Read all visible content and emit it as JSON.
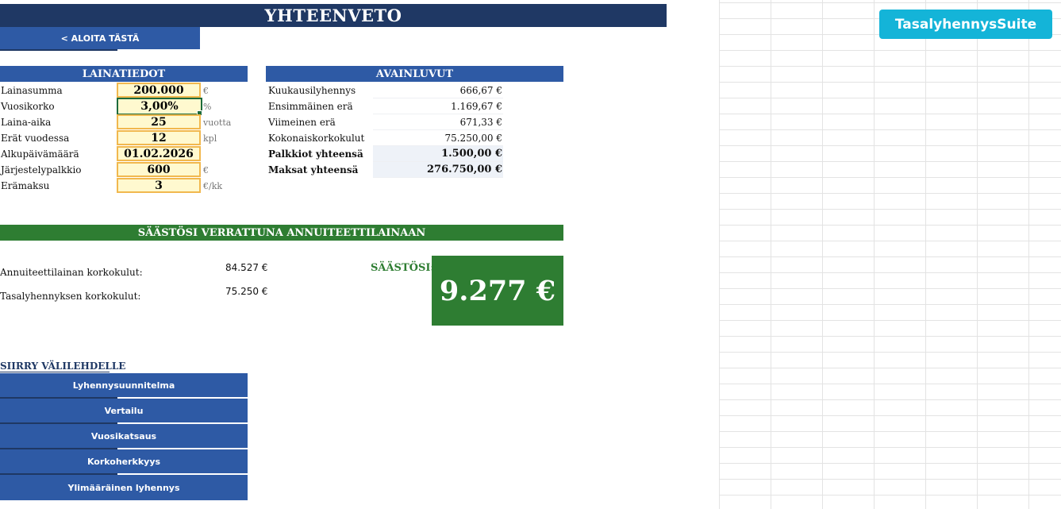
{
  "header": {
    "title": "YHTEENVETO",
    "start_label": "< ALOITA TÄSTÄ",
    "brand_label": "TasalyhennysSuite"
  },
  "loan": {
    "heading": "LAINATIEDOT",
    "rows": [
      {
        "label": "Lainasumma",
        "value": "200.000",
        "unit": "€"
      },
      {
        "label": "Vuosikorko",
        "value": "3,00%",
        "unit": "%"
      },
      {
        "label": "Laina-aika",
        "value": "25",
        "unit": "vuotta"
      },
      {
        "label": "Erät vuodessa",
        "value": "12",
        "unit": "kpl"
      },
      {
        "label": "Alkupäivämäärä",
        "value": "01.02.2026",
        "unit": ""
      },
      {
        "label": "Järjestelypalkkio",
        "value": "600",
        "unit": "€"
      },
      {
        "label": "Erämaksu",
        "value": "3",
        "unit": "€/kk"
      }
    ]
  },
  "keys": {
    "heading": "AVAINLUVUT",
    "rows": [
      {
        "label": "Kuukausilyhennys",
        "value": "666,67 €"
      },
      {
        "label": "Ensimmäinen erä",
        "value": "1.169,67 €"
      },
      {
        "label": "Viimeinen erä",
        "value": "671,33 €"
      },
      {
        "label": "Kokonaiskorkokulut",
        "value": "75.250,00 €"
      },
      {
        "label": "Palkkiot yhteensä",
        "value": "1.500,00 €"
      },
      {
        "label": "Maksat yhteensä",
        "value": "276.750,00 €"
      }
    ]
  },
  "comparison": {
    "heading": "SÄÄSTÖSI VERRATTUNA ANNUITEETTILAINAAN",
    "annuity_label": "Annuiteettilainan korkokulut:",
    "annuity_value": "84.527 €",
    "flat_label": "Tasalyhennyksen korkokulut:",
    "flat_value": "75.250 €",
    "savings_label": "SÄÄSTÖSI:",
    "savings_value": "9.277 €"
  },
  "navigation": {
    "heading": "SIIRRY VÄLILEHDELLE",
    "items": [
      "Lyhennysuunnitelma",
      "Vertailu",
      "Vuosikatsaus",
      "Korkoherkkyys",
      "Ylimääräinen lyhennys"
    ]
  },
  "colors": {
    "title": "#1f3864",
    "section": "#2e5aa5",
    "green": "#2e7d32",
    "brand": "#14b4d8",
    "input_bg": "#fff9cf",
    "input_border": "#f1b84e"
  }
}
